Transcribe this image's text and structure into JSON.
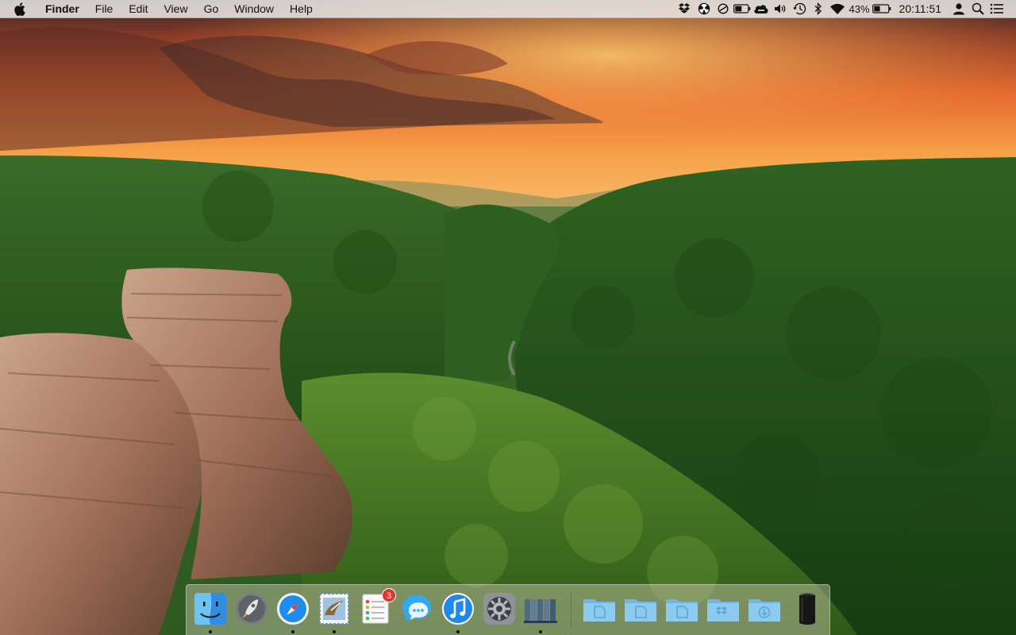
{
  "menubar": {
    "app_name": "Finder",
    "menus": [
      "File",
      "Edit",
      "View",
      "Go",
      "Window",
      "Help"
    ],
    "battery_percent_label": "43%",
    "battery_level": 0.43,
    "clock": "20:11:51",
    "status_icons": [
      "dropbox-icon",
      "radiation-icon",
      "sync-icon",
      "battery-small-icon",
      "cloud-icon",
      "volume-icon",
      "time-machine-icon",
      "bluetooth-icon",
      "wifi-icon",
      "battery-icon",
      "user-icon",
      "spotlight-icon",
      "notification-center-icon"
    ]
  },
  "dock": {
    "apps": [
      {
        "name": "finder",
        "icon": "finder-icon",
        "running": true
      },
      {
        "name": "launchpad",
        "icon": "launchpad-icon",
        "running": false
      },
      {
        "name": "safari",
        "icon": "safari-icon",
        "running": true
      },
      {
        "name": "mail",
        "icon": "mail-icon",
        "running": true
      },
      {
        "name": "reminders",
        "icon": "reminders-icon",
        "running": false,
        "badge": "3"
      },
      {
        "name": "messages",
        "icon": "messages-icon",
        "running": false
      },
      {
        "name": "itunes",
        "icon": "itunes-icon",
        "running": true
      },
      {
        "name": "system-preferences",
        "icon": "gear-icon",
        "running": false
      },
      {
        "name": "books",
        "icon": "books-icon",
        "running": true
      }
    ],
    "folders": [
      {
        "name": "applications-folder",
        "icon": "folder-icon"
      },
      {
        "name": "documents-folder",
        "icon": "folder-icon"
      },
      {
        "name": "documents-folder-2",
        "icon": "folder-icon"
      },
      {
        "name": "dropbox-folder",
        "icon": "dropbox-folder-icon"
      },
      {
        "name": "downloads-folder",
        "icon": "downloads-folder-icon"
      },
      {
        "name": "trash",
        "icon": "trash-icon"
      }
    ]
  },
  "colors": {
    "menubar_bg": "#ECE9E6",
    "folder_blue": "#8ccbef",
    "badge_red": "#e0362f"
  }
}
